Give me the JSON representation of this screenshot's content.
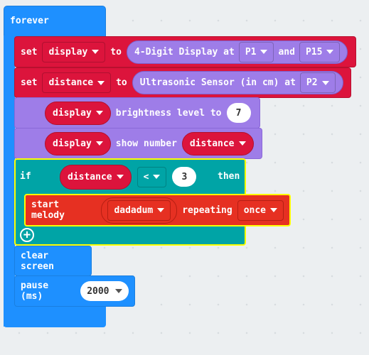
{
  "forever": {
    "label": "forever"
  },
  "set_display": {
    "set": "set",
    "variable": "display",
    "to": "to",
    "value": {
      "label": "4-Digit Display at",
      "pin1": "P1",
      "and": "and",
      "pin2": "P15"
    }
  },
  "set_distance": {
    "set": "set",
    "variable": "distance",
    "to": "to",
    "value": {
      "label": "Ultrasonic Sensor (in cm) at",
      "pin": "P2"
    }
  },
  "brightness": {
    "variable": "display",
    "label": "brightness level to",
    "value": "7"
  },
  "show_number": {
    "variable": "display",
    "label": "show number",
    "value": "distance"
  },
  "if_block": {
    "if": "if",
    "variable": "distance",
    "operator": "<",
    "value": "3",
    "then": "then",
    "melody": {
      "label": "start melody",
      "melody": "dadadum",
      "repeating": "repeating",
      "mode": "once"
    }
  },
  "clear_screen": {
    "label": "clear screen"
  },
  "pause": {
    "label": "pause (ms)",
    "value": "2000"
  },
  "colors": {
    "basic": "#1e90ff",
    "variables": "#dc143c",
    "display": "#9e7de8",
    "logic": "#00a4a6",
    "music": "#e63022",
    "selected": "#ffff00"
  }
}
